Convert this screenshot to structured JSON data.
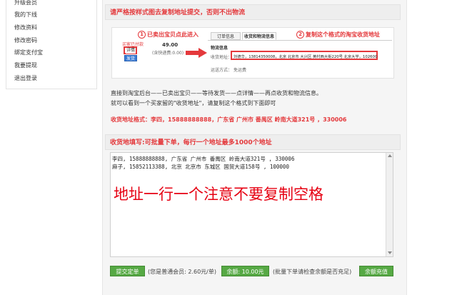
{
  "sidebar": {
    "items": [
      {
        "label": "升级会员"
      },
      {
        "label": "我的下线"
      },
      {
        "label": "修改资料"
      },
      {
        "label": "修改密码"
      },
      {
        "label": "绑定支付宝"
      },
      {
        "label": "我要提现"
      },
      {
        "label": "退出登录"
      }
    ]
  },
  "section1": {
    "title": "请严格按样式图去复制地址提交，否则不出物流"
  },
  "demo": {
    "step1_num": "1",
    "step1_label": "已卖出宝贝点此进入",
    "step2_num": "2",
    "step2_label": "复制这个格式的淘宝收货地址",
    "mini_status": "买家已付款",
    "mini_btn1": "详情",
    "mini_btn2": "发货",
    "price": "49.00",
    "price_note": "(含快递费:0.00)",
    "tab1": "订单信息",
    "tab2": "收货和物流信息",
    "logistics_title": "物流信息",
    "address_label": "收货地址：",
    "address_value": "刘德华，13814350008，北京 北京市 大兴区 黄村西大街220号 北京大学，102600",
    "shipping_label": "运送方式：",
    "shipping_value": "免运费"
  },
  "instructions": {
    "line1": "直接到淘宝后台——已卖出宝贝——等待发货——点详情——再点收货和物流信息。",
    "line2": "就可以看到一个买家留的\"收货地址\"，请复制这个格式到下面即可",
    "format_example": "收货地址格式：李四，15888888888，广东省 广州市 番禺区 岭南大道321号 ，330006"
  },
  "section2": {
    "title": "收货地填写:可批量下单，每行一个地址最多1000个地址"
  },
  "textarea": {
    "lines": [
      "李四, 15888888888, 广东省 广州市 番禺区 岭南大道321号 , 330006",
      "麻子, 15852113388, 北京 北京市 东城区 国贸大道158号 , 100000"
    ],
    "overlay_note": "地址一行一个注意不要复制空格"
  },
  "footer": {
    "submit_label": "提交定单",
    "member_note": "(您是普通会员: 2.60元/单)",
    "balance_label": "余额: 10.00元",
    "balance_hint": "(批量下单请检查余额是否充足)",
    "recharge_label": "余额充值"
  },
  "colors": {
    "accent_red": "#e4393c",
    "button_green": "#56a944"
  }
}
